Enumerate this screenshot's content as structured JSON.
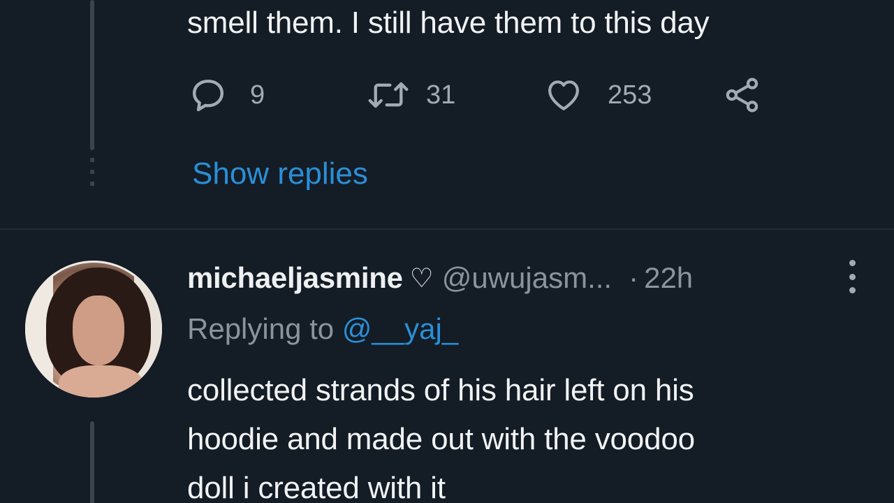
{
  "tweet_prev": {
    "text_tail": "smell them. I still have them to this day",
    "actions": {
      "reply_icon": "reply-bubble-icon",
      "reply_count": "9",
      "retweet_icon": "retweet-icon",
      "retweet_count": "31",
      "like_icon": "heart-icon",
      "like_count": "253",
      "share_icon": "share-icon"
    },
    "show_replies": "Show replies"
  },
  "tweet": {
    "display_name": "michaeljasmine",
    "name_emoji": "♡",
    "handle": "@uwujasm...",
    "separator": "·",
    "time": "22h",
    "replying_prefix": "Replying to",
    "replying_to": "@__yaj_",
    "text_lines": [
      "collected strands of his hair left on his",
      "hoodie and made out with the voodoo",
      "doll i created with it"
    ]
  },
  "colors": {
    "background": "#141c26",
    "link": "#2a8fd6",
    "secondary_text": "#8b949e",
    "primary_text": "#f1f3f4"
  }
}
